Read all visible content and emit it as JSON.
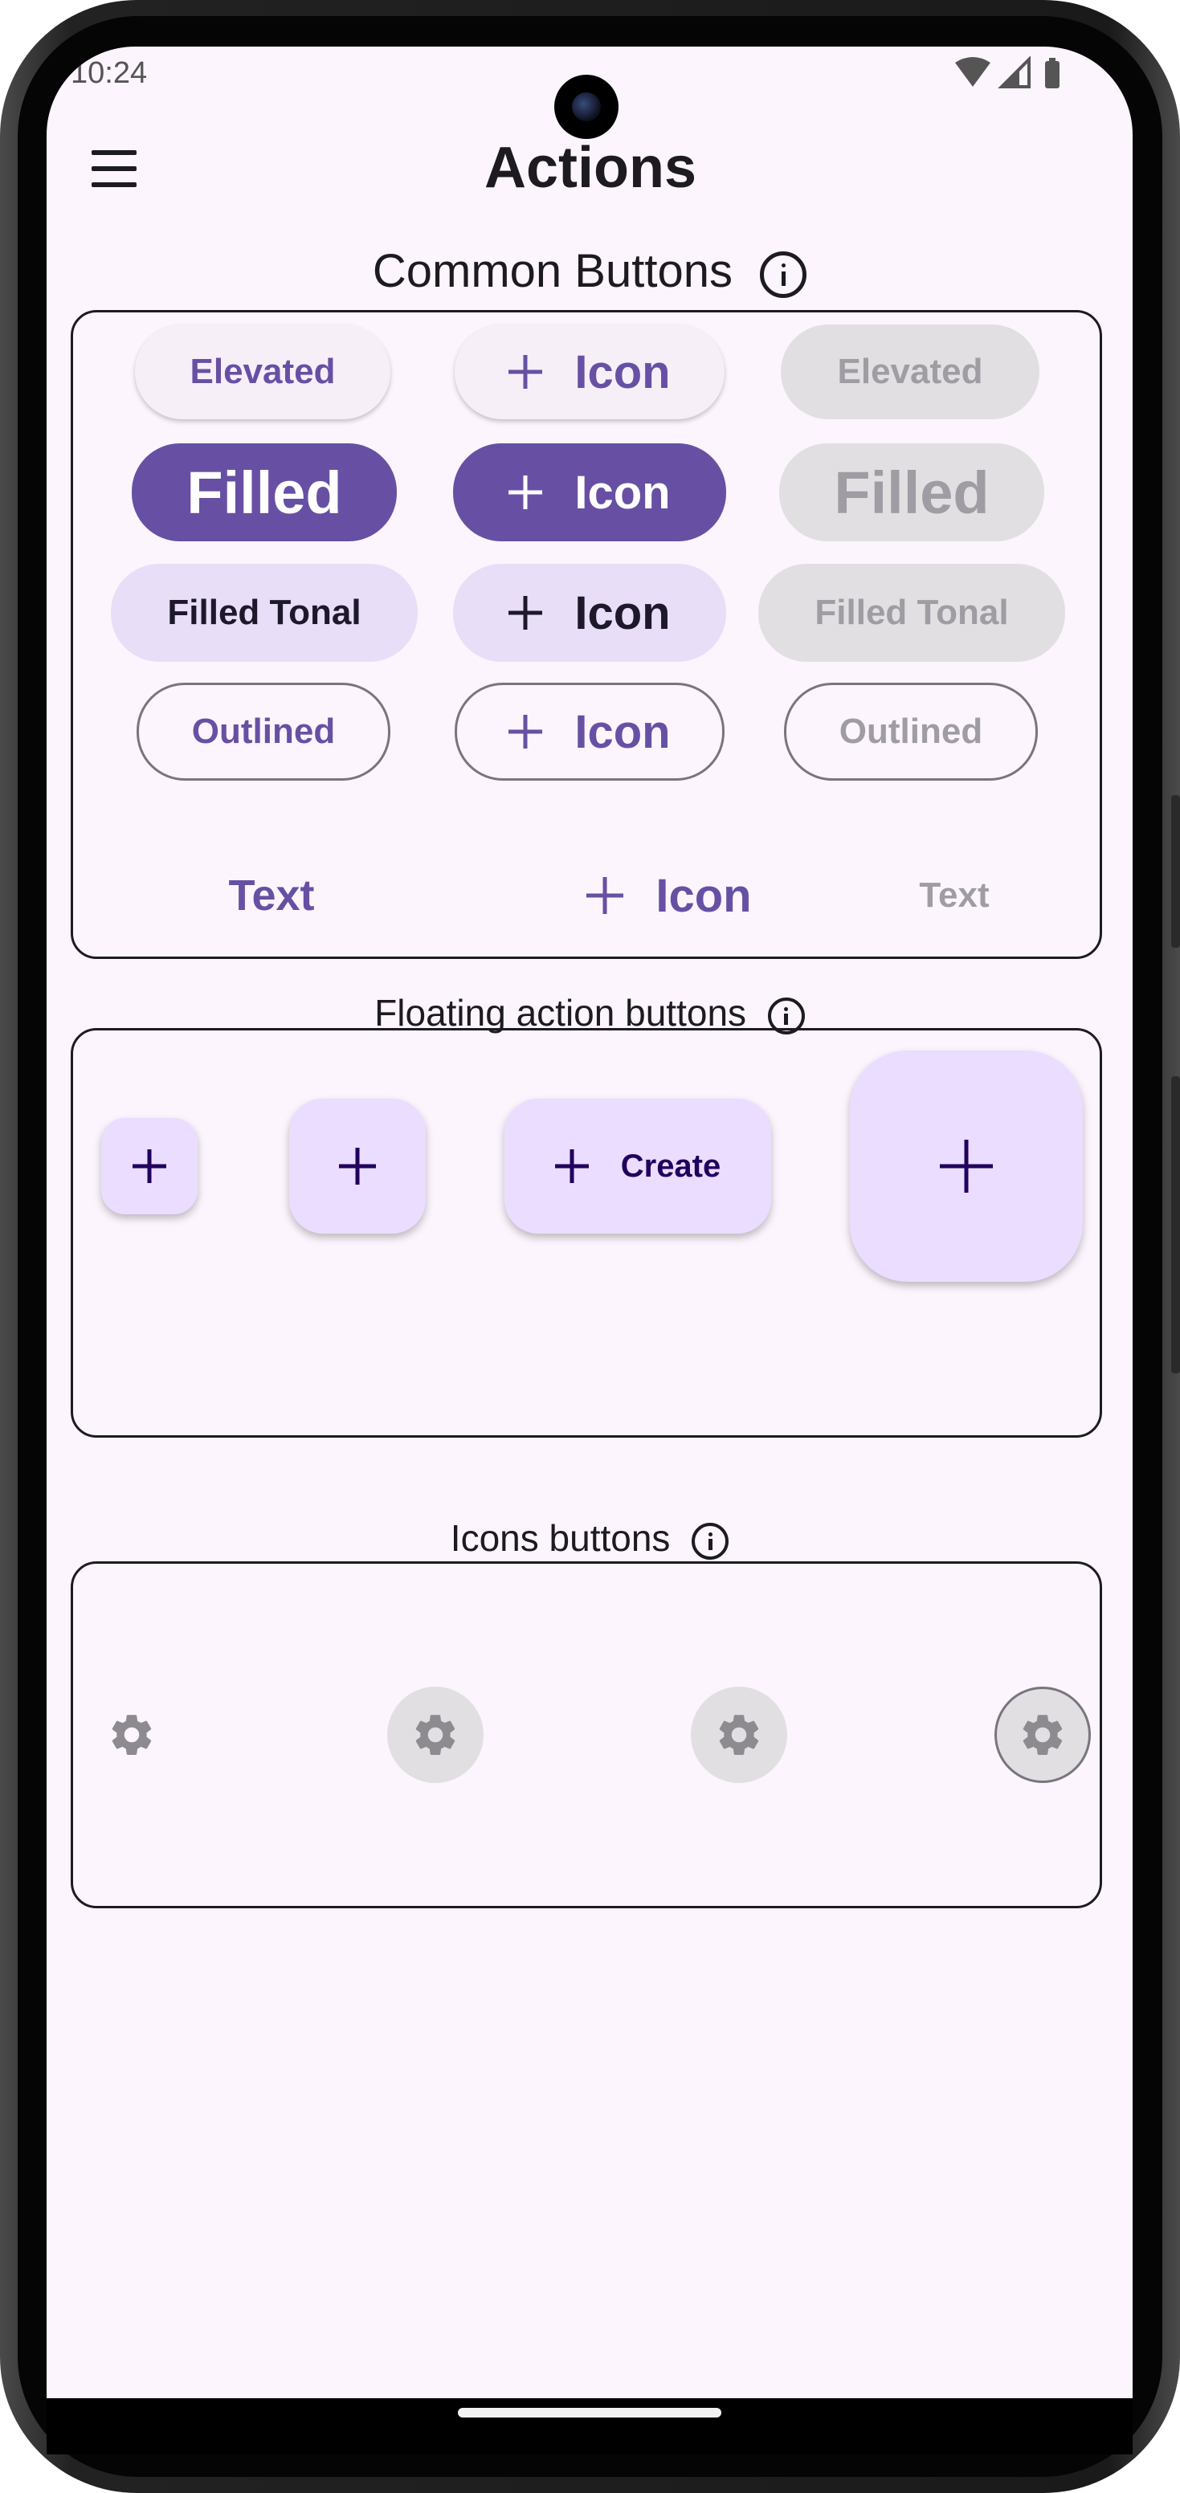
{
  "status_bar": {
    "time": "10:24"
  },
  "app_bar": {
    "title": "Actions"
  },
  "sections": {
    "common": {
      "title": "Common Buttons"
    },
    "fab": {
      "title": "Floating action buttons"
    },
    "icons": {
      "title": "Icons buttons"
    }
  },
  "common_buttons": {
    "elevated": "Elevated",
    "elevated_icon": "Icon",
    "elevated_disabled": "Elevated",
    "filled": "Filled",
    "filled_icon": "Icon",
    "filled_disabled": "Filled",
    "tonal": "Filled Tonal",
    "tonal_icon": "Icon",
    "tonal_disabled": "Filled Tonal",
    "outlined": "Outlined",
    "outlined_icon": "Icon",
    "outlined_disabled": "Outlined",
    "text": "Text",
    "text_icon": "Icon",
    "text_disabled": "Text"
  },
  "fab_buttons": {
    "extended_label": "Create"
  },
  "icon_buttons": {
    "icon": "gear-icon"
  },
  "colors": {
    "primary": "#6750a4",
    "background": "#fcf5fd",
    "tonal": "#e8def8",
    "fab": "#eaddff",
    "disabled": "#e2dfe3",
    "on_surface": "#1d1b20"
  }
}
